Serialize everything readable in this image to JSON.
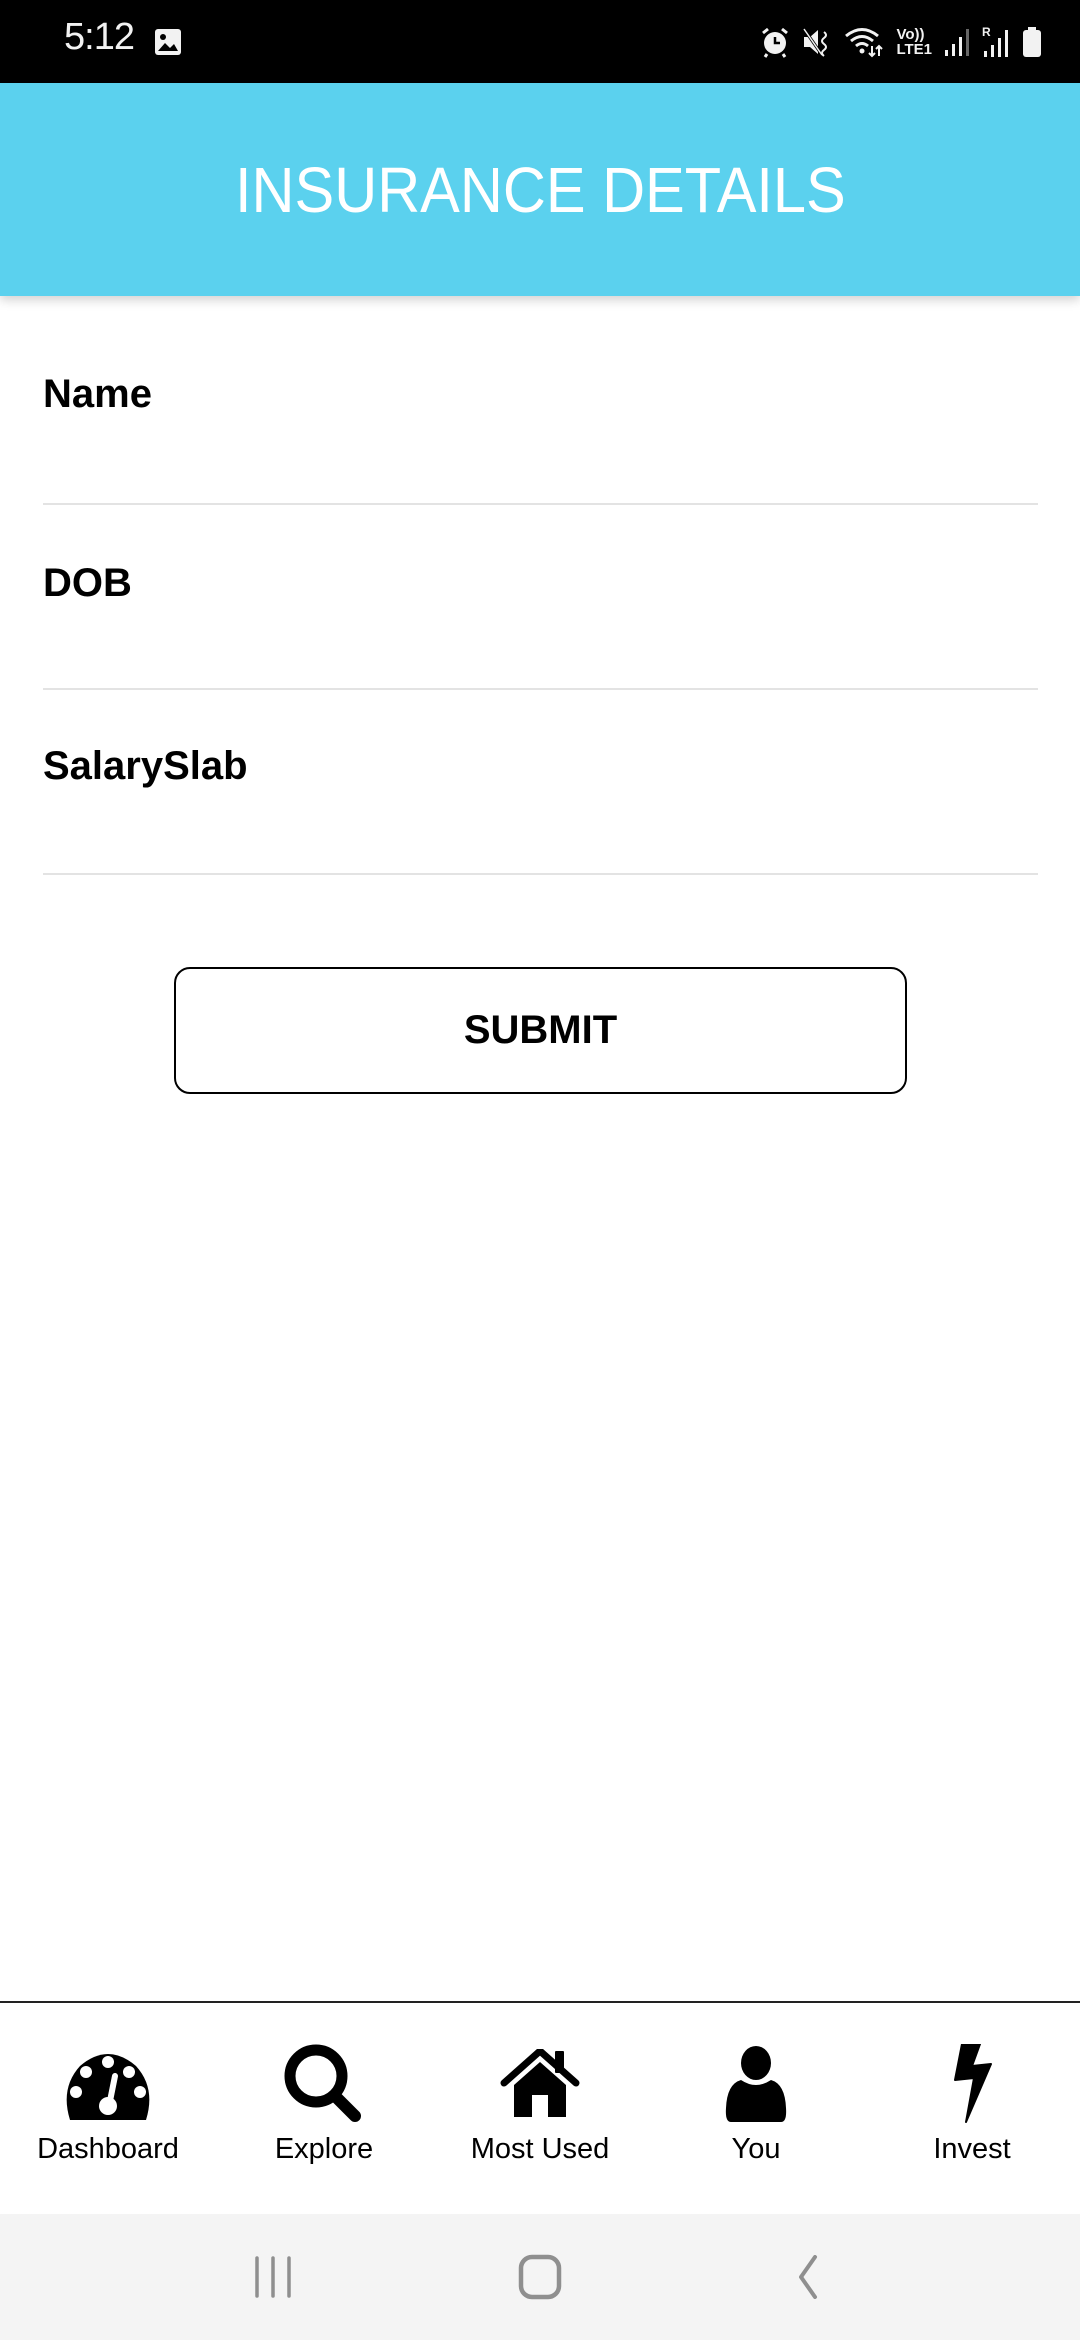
{
  "status_bar": {
    "time": "5:12",
    "left_icons": [
      "gallery-icon"
    ],
    "right_icons": [
      "alarm-icon",
      "mute-icon",
      "wifi-icon",
      "volte-lte-icon",
      "signal-icon",
      "roaming-signal-icon",
      "battery-icon"
    ],
    "volte_line1": "Vo))",
    "volte_line2": "LTE1",
    "roaming_label": "R"
  },
  "app_bar": {
    "title": "INSURANCE DETAILS",
    "background_color": "#5bd1ee"
  },
  "form": {
    "fields": [
      {
        "label": "Name",
        "value": "",
        "placeholder": ""
      },
      {
        "label": "DOB",
        "value": "",
        "placeholder": ""
      },
      {
        "label": "SalarySlab",
        "value": "",
        "placeholder": ""
      }
    ],
    "submit_label": "SUBMIT"
  },
  "bottom_nav": {
    "items": [
      {
        "label": "Dashboard",
        "icon": "dashboard-gauge-icon"
      },
      {
        "label": "Explore",
        "icon": "search-icon"
      },
      {
        "label": "Most Used",
        "icon": "home-icon"
      },
      {
        "label": "You",
        "icon": "user-icon"
      },
      {
        "label": "Invest",
        "icon": "lightning-bolt-icon"
      }
    ]
  },
  "system_nav": {
    "buttons": [
      "recent-apps",
      "home",
      "back"
    ]
  }
}
